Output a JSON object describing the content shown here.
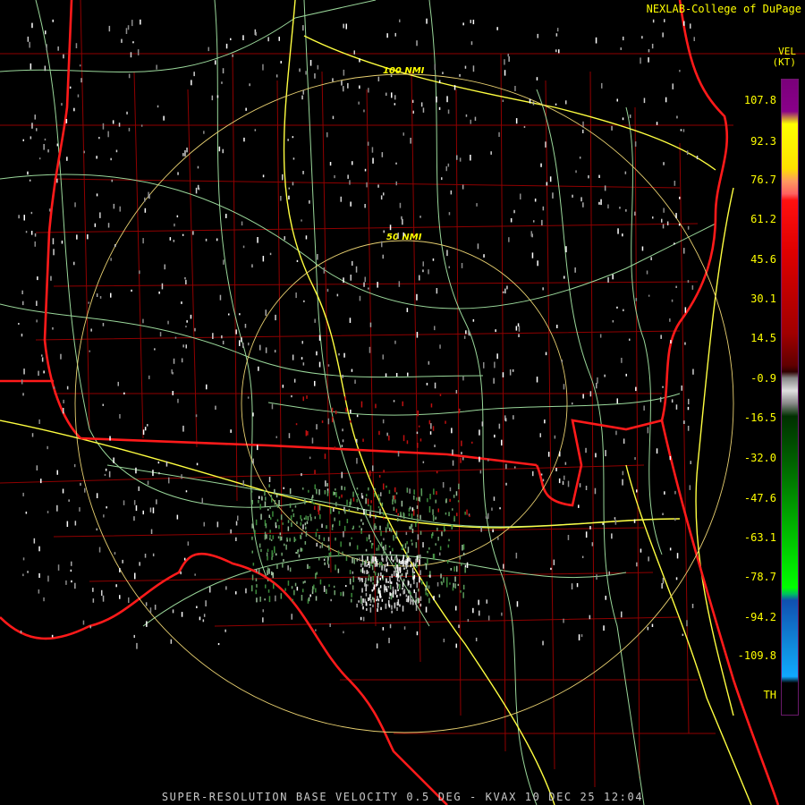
{
  "header": {
    "credit": "NEXLAB-College of DuPage"
  },
  "map": {
    "rings": [
      {
        "label": "50 NMI"
      },
      {
        "label": "100 NMI"
      }
    ],
    "colors": {
      "state_border": "#ff1a1a",
      "county_border": "#b00000",
      "highway": "#ffff40",
      "road": "#9ad79a",
      "range_ring": "#e8d070"
    }
  },
  "legend": {
    "title": "VEL",
    "units": "(KT)",
    "ticks": [
      "107.8",
      "92.3",
      "76.7",
      "61.2",
      "45.6",
      "30.1",
      "14.5",
      "-0.9",
      "-16.5",
      "-32.0",
      "-47.6",
      "-63.1",
      "-78.7",
      "-94.2",
      "-109.8",
      "TH"
    ]
  },
  "footer": {
    "product": "SUPER-RESOLUTION BASE VELOCITY 0.5 DEG - KVAX 10 DEC 25 12:04"
  }
}
